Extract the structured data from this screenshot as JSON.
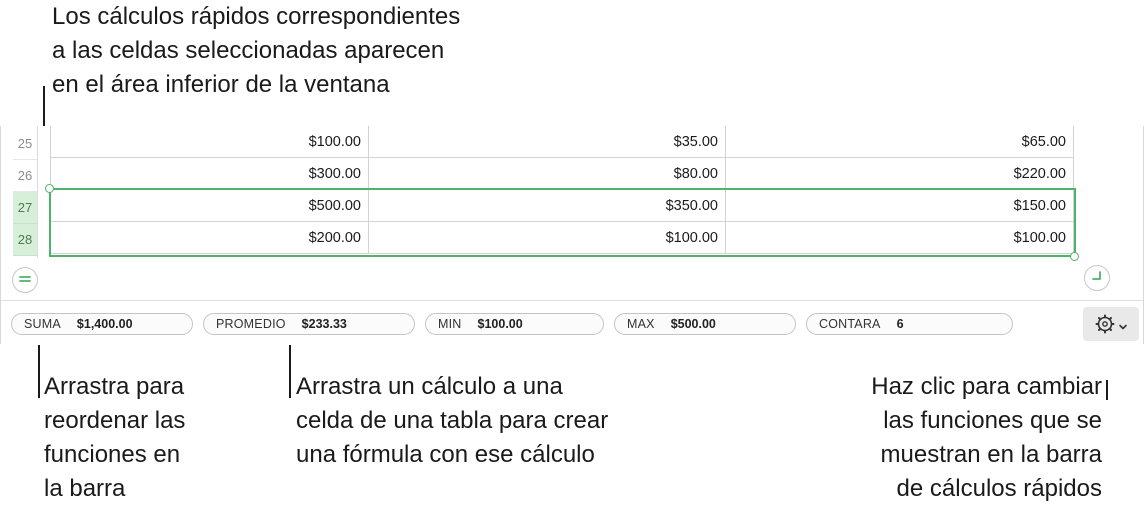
{
  "callouts": {
    "top": "Los cálculos rápidos correspondientes\na las celdas seleccionadas aparecen\nen el área inferior de la ventana",
    "reorder": "Arrastra para\nreordenar las\nfunciones en\nla barra",
    "drag": "Arrastra un cálculo a una\ncelda de una tabla para crear\nuna fórmula con ese cálculo",
    "change": "Haz clic para cambiar\nlas funciones que se\nmuestran en la barra\nde cálculos rápidos"
  },
  "table": {
    "rows": [
      {
        "num": "25",
        "selected": false,
        "cells": [
          "$100.00",
          "$35.00",
          "$65.00"
        ]
      },
      {
        "num": "26",
        "selected": false,
        "cells": [
          "$300.00",
          "$80.00",
          "$220.00"
        ]
      },
      {
        "num": "27",
        "selected": true,
        "cells": [
          "$500.00",
          "$350.00",
          "$150.00"
        ]
      },
      {
        "num": "28",
        "selected": true,
        "cells": [
          "$200.00",
          "$100.00",
          "$100.00"
        ]
      }
    ]
  },
  "quick_calc": {
    "items": [
      {
        "label": "SUMA",
        "value": "$1,400.00"
      },
      {
        "label": "PROMEDIO",
        "value": "$233.33"
      },
      {
        "label": "MIN",
        "value": "$100.00"
      },
      {
        "label": "MAX",
        "value": "$500.00"
      },
      {
        "label": "CONTARA",
        "value": "6"
      }
    ]
  },
  "icons": {
    "add_row": "equals-icon",
    "resize": "resize-corner-icon",
    "settings": "gear-icon",
    "dropdown": "chevron-down-icon"
  },
  "colors": {
    "selection": "#4db36a",
    "selected_row_header": "#d7eed9",
    "text": "#1a1a1a"
  }
}
